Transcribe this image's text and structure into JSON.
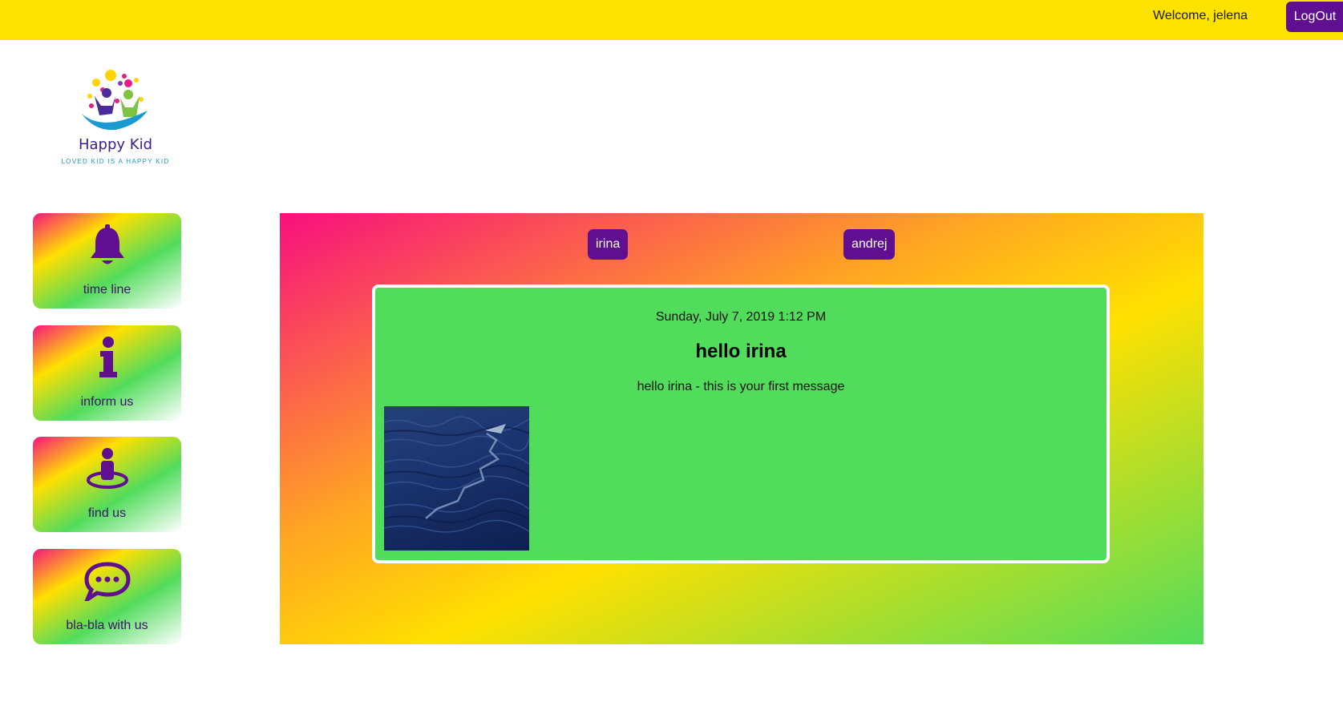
{
  "header": {
    "welcome_text": "Welcome, jelena",
    "logout_label": "LogOut"
  },
  "logo": {
    "title": "Happy Kid",
    "tagline": "LOVED KID IS A HAPPY KID"
  },
  "sidebar": {
    "items": [
      {
        "label": "time line",
        "icon": "bell-icon"
      },
      {
        "label": "inform us",
        "icon": "info-icon"
      },
      {
        "label": "find us",
        "icon": "location-person-icon"
      },
      {
        "label": "bla-bla with us",
        "icon": "chat-bubble-icon"
      }
    ]
  },
  "main": {
    "tabs": [
      {
        "label": "irina"
      },
      {
        "label": "andrej"
      }
    ],
    "message": {
      "date": "Sunday, July 7, 2019 1:12 PM",
      "title": "hello irina",
      "body": "hello irina - this is your first message"
    }
  },
  "colors": {
    "topbar": "#FFE300",
    "accent_purple": "#5F0F8F",
    "card_green": "#52DC5C",
    "gradient_pink": "#F7157E",
    "gradient_yellow": "#FFE000"
  }
}
